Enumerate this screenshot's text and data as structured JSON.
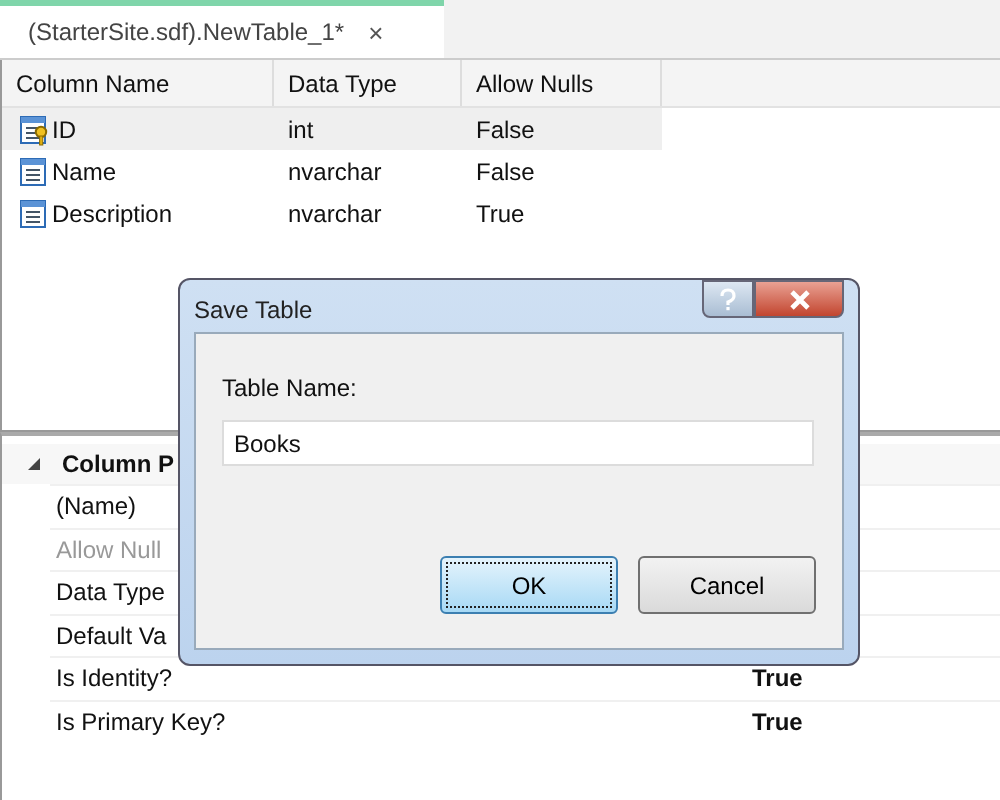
{
  "tabs": [
    {
      "label": "(StarterSite.sdf).NewTable_1*",
      "close": "×",
      "selected": true
    }
  ],
  "table": {
    "columns": [
      "Column Name",
      "Data Type",
      "Allow Nulls"
    ],
    "rows": [
      {
        "key": true,
        "selected": true,
        "cells": [
          "ID",
          "int",
          "False"
        ]
      },
      {
        "key": false,
        "selected": false,
        "cells": [
          "Name",
          "nvarchar",
          "False"
        ]
      },
      {
        "key": false,
        "selected": false,
        "cells": [
          "Description",
          "nvarchar",
          "True"
        ]
      }
    ]
  },
  "properties": {
    "title": "Column P",
    "expanded": true,
    "rows": [
      {
        "label": "(Name)",
        "disabled": false
      },
      {
        "label": "Allow Null",
        "disabled": true
      },
      {
        "label": "Data Type",
        "disabled": false
      },
      {
        "label": "Default Va",
        "disabled": false
      },
      {
        "label": "Is Identity?",
        "value": "True",
        "disabled": false
      },
      {
        "label": "Is Primary Key?",
        "value": "True",
        "disabled": false
      }
    ]
  },
  "dialog": {
    "title": "Save Table",
    "field_label": "Table Name:",
    "value": "Books",
    "buttons": [
      {
        "label": "OK",
        "default": true
      },
      {
        "label": "Cancel",
        "default": false
      }
    ]
  }
}
